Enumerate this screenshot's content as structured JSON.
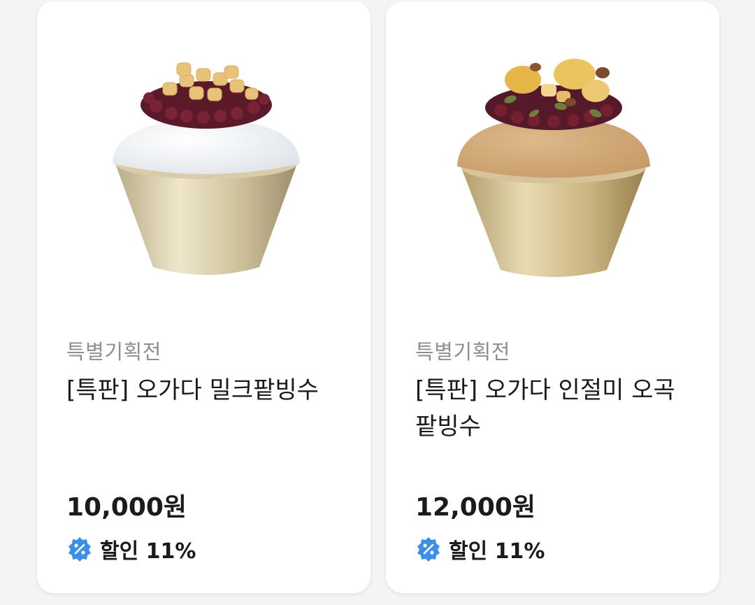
{
  "colors": {
    "badge_blue": "#3d8ee6",
    "card_bg": "#ffffff",
    "page_bg": "#f3f4f6",
    "category_gray": "#8e8e93",
    "text_dark": "#1b1b1b"
  },
  "products": [
    {
      "image_icon": "milk-red-bean-bingsu-image",
      "category": "특별기획전",
      "title": "[특판] 오가다 밀크팥빙수",
      "price": "10,000원",
      "discount_icon": "percent-badge-icon",
      "discount": "할인 11%"
    },
    {
      "image_icon": "injeolmi-grain-red-bean-bingsu-image",
      "category": "특별기획전",
      "title": "[특판] 오가다 인절미 오곡 팥빙수",
      "price": "12,000원",
      "discount_icon": "percent-badge-icon",
      "discount": "할인 11%"
    }
  ]
}
